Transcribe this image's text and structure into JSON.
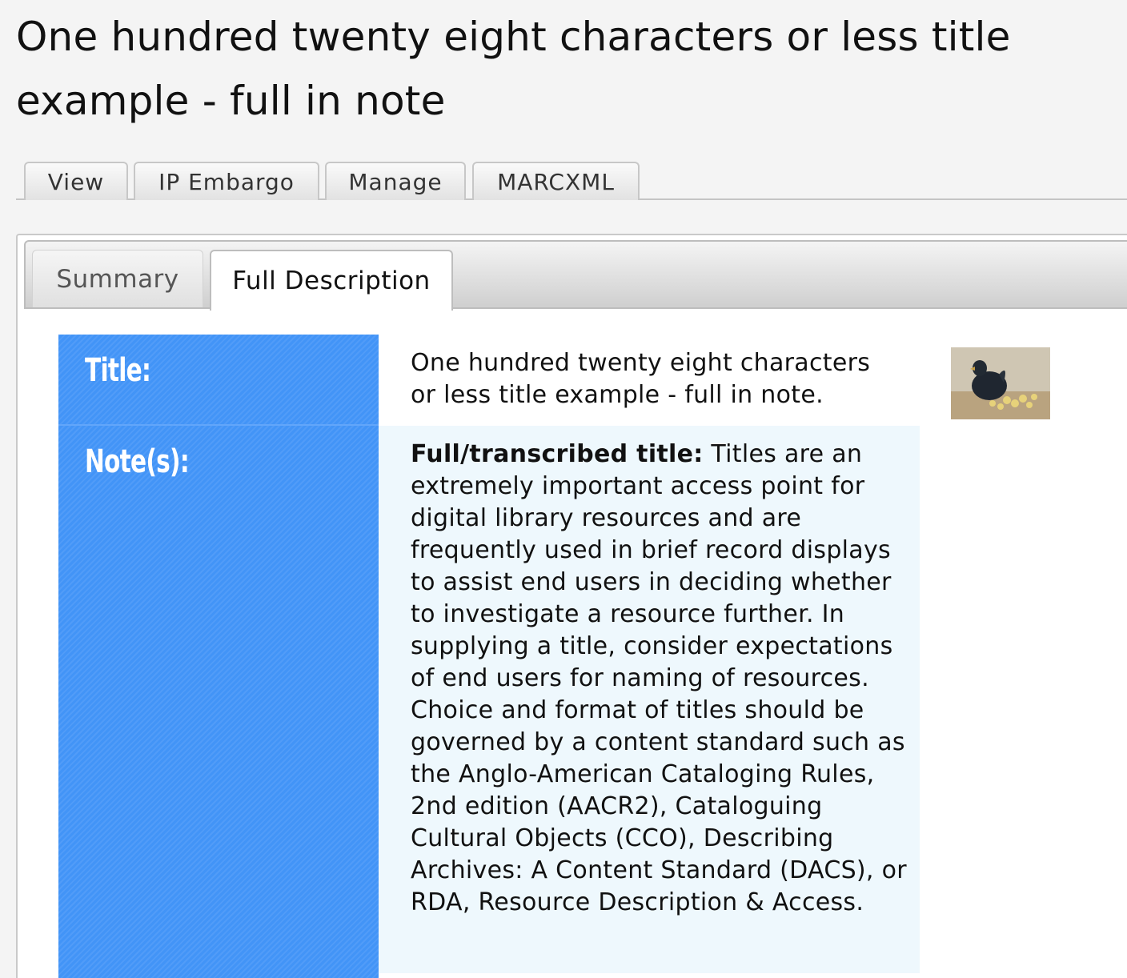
{
  "page": {
    "title": "One hundred twenty eight characters or less title example - full in note"
  },
  "top_tabs": [
    {
      "label": "View"
    },
    {
      "label": "IP Embargo"
    },
    {
      "label": "Manage"
    },
    {
      "label": "MARCXML"
    }
  ],
  "sub_tabs": {
    "summary": "Summary",
    "full_description": "Full Description",
    "active": "Full Description"
  },
  "record": {
    "title_label": "Title:",
    "title_value": "One hundred twenty eight characters or less title example - full in note.",
    "notes_label": "Note(s):",
    "note_heading": "Full/transcribed title:",
    "note_text": " Titles are an extremely important access point for digital library resources and are frequently used in brief record displays to assist end users in deciding whether to investigate a resource further. In supplying a title, consider expectations of end users for naming of resources. Choice and format of titles should be governed by a content standard such as the Anglo-American Cataloging Rules, 2nd edition (AACR2), Cataloguing Cultural Objects (CCO), Describing Archives: A Content Standard (DACS), or RDA, Resource Description & Access."
  },
  "thumbnail": {
    "icon": "hen-with-chicks-thumbnail"
  },
  "colors": {
    "label_column": "#4294f7",
    "note_background": "#eef8fd",
    "page_background": "#f4f4f4"
  }
}
